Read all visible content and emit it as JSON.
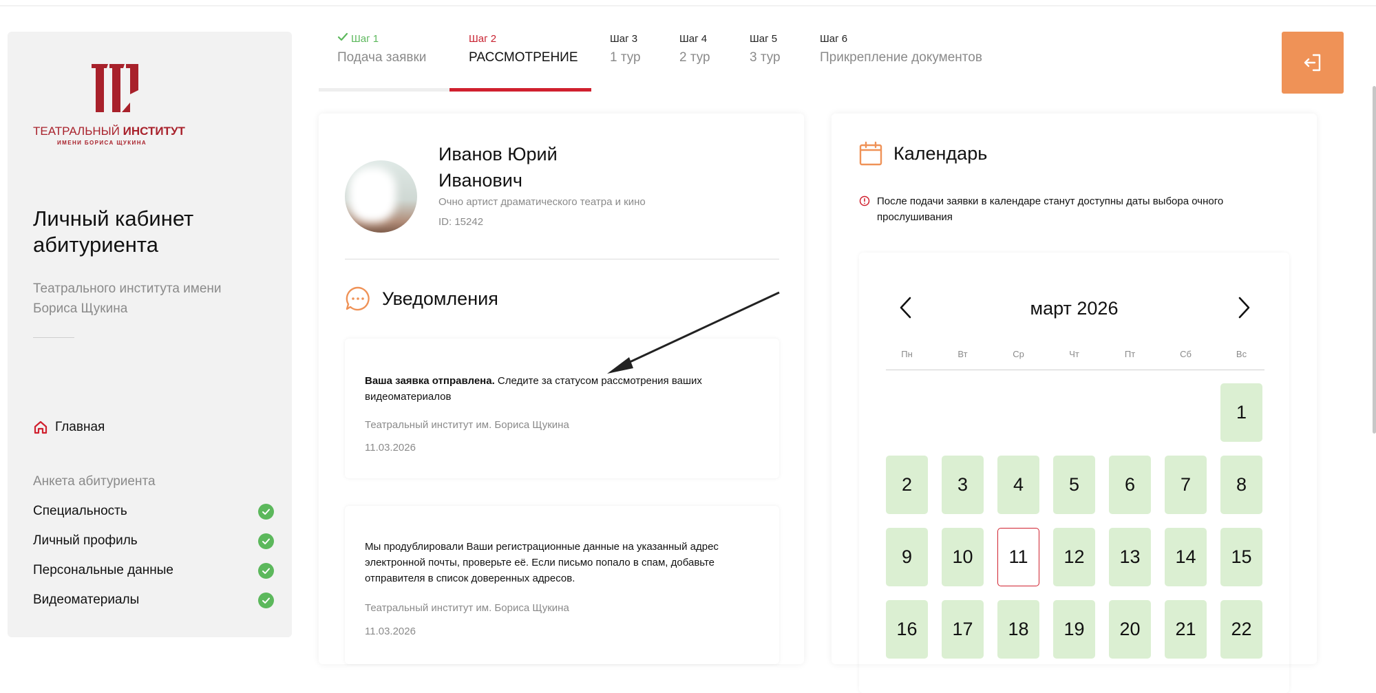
{
  "sidebar": {
    "logo_line1_a": "ТЕАТРАЛЬНЫЙ",
    "logo_line1_b": "ИНСТИТУТ",
    "logo_line2": "ИМЕНИ БОРИСА ЩУКИНА",
    "cabinet_title": "Личный кабинет абитуриента",
    "cabinet_subtitle": "Театрального института имени Бориса Щукина",
    "home_label": "Главная",
    "anketa_heading": "Анкета абитуриента",
    "anketa_items": [
      {
        "label": "Специальность",
        "done": true
      },
      {
        "label": "Личный профиль",
        "done": true
      },
      {
        "label": "Персональные данные",
        "done": true
      },
      {
        "label": "Видеоматериалы",
        "done": true
      }
    ]
  },
  "steps": [
    {
      "num": "Шаг 1",
      "name": "Подача заявки",
      "state": "done"
    },
    {
      "num": "Шаг 2",
      "name": "РАССМОТРЕНИЕ",
      "state": "active"
    },
    {
      "num": "Шаг 3",
      "name": "1 тур",
      "state": "pending"
    },
    {
      "num": "Шаг 4",
      "name": "2 тур",
      "state": "pending"
    },
    {
      "num": "Шаг 5",
      "name": "3 тур",
      "state": "pending"
    },
    {
      "num": "Шаг 6",
      "name": "Прикрепление документов",
      "state": "pending"
    }
  ],
  "profile": {
    "name_line1": "Иванов Юрий",
    "name_line2": "Иванович",
    "specialty": "Очно артист драматического театра и кино",
    "id_text": "ID: 15242"
  },
  "notifications": {
    "title": "Уведомления",
    "items": [
      {
        "bold": "Ваша заявка отправлена.",
        "text": " Следите за статусом рассмотрения ваших видеоматериалов",
        "source": "Театральный институт им. Бориса Щукина",
        "date": "11.03.2026"
      },
      {
        "bold": "",
        "text": "Мы продублировали Ваши регистрационные данные на указанный адрес электронной почты, проверьте её. Если письмо попало в спам, добавьте отправителя в список доверенных адресов.",
        "source": "Театральный институт им. Бориса Щукина",
        "date": "11.03.2026"
      }
    ]
  },
  "calendar": {
    "title": "Календарь",
    "info": "После подачи заявки в календаре станут доступны даты выбора очного прослушивания",
    "month": "март 2026",
    "weekdays": [
      "Пн",
      "Вт",
      "Ср",
      "Чт",
      "Пт",
      "Сб",
      "Вс"
    ],
    "start_weekday_index": 6,
    "today": 11,
    "days": [
      1,
      2,
      3,
      4,
      5,
      6,
      7,
      8,
      9,
      10,
      11,
      12,
      13,
      14,
      15,
      16,
      17,
      18,
      19,
      20,
      21,
      22
    ]
  },
  "colors": {
    "accent_red": "#d0202e",
    "done_green": "#5cb85c",
    "orange": "#ef9257",
    "day_green": "#dbefd2"
  }
}
